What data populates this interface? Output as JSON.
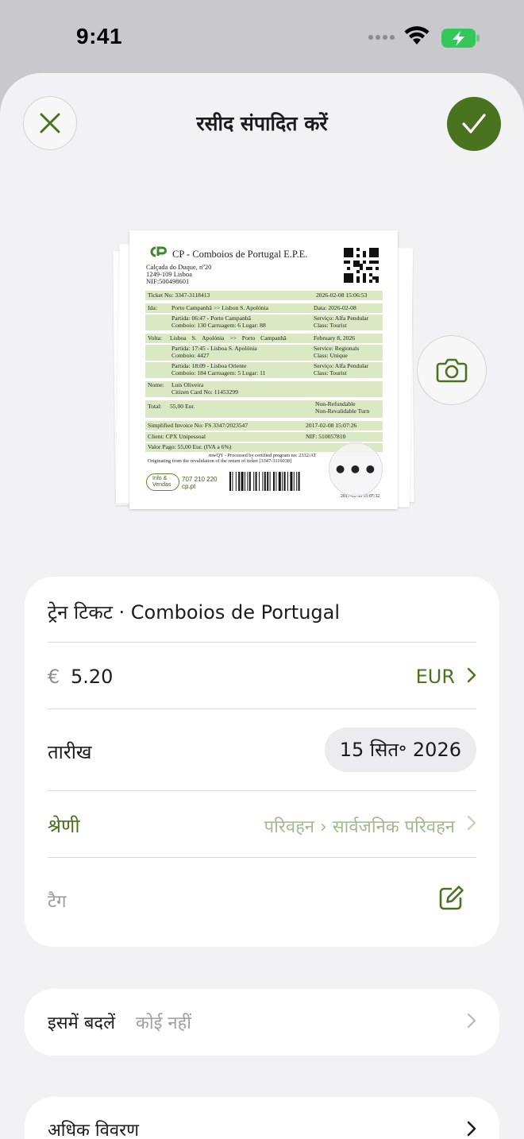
{
  "status_bar": {
    "time": "9:41"
  },
  "header": {
    "title": "रसीद संपादित करें"
  },
  "receipt": {
    "company": "CP - Comboios de Portugal E.P.E.",
    "address": [
      "Calçada do Duque, nº20",
      "1249-109 Lisboa",
      "NIF:500498601"
    ],
    "ticket_no": "Ticket No: 3347-3118413",
    "ticket_datetime": "2026-02-08 15:06:53",
    "ida_label": "Ida:",
    "ida_route": "Porto Campanhã >> Lisbon S. Apolónia",
    "ida_date": "Data: 2026-02-08",
    "ida_partida": "Partida: 06:47 - Porto Campanhã",
    "ida_comboio": "Comboio: 130 Carruagem: 6 Lugar: 88",
    "ida_servico": "Serviço: Alfa Pendular",
    "ida_class": "Class: Tourist",
    "volta_label": "Volta:",
    "volta_route": "Lisboa S. Apolónia >> Porto Campanhã",
    "volta_date": "February 8, 2026",
    "volta_partida1": "Partida: 17:45 - Lisboa S. Apolónia",
    "volta_comboio1": "Comboio: 4427",
    "volta_service1": "Service: Regionals",
    "volta_class1": "Class: Unique",
    "volta_partida2": "Partida: 18:09 - Lisboa Oriente",
    "volta_comboio2": "Comboio: 184 Carruagem: 5 Lugar: 11",
    "volta_servico2": "Serviço: Alfa Pendular",
    "volta_class2": "Class: Tourist",
    "name_label": "Nome:",
    "name_value": "Luis Oliveira",
    "citizen_card": "Citizen Card No: 11453299",
    "total_label": "Total:",
    "total_value": "55,00 Eur.",
    "non_refundable": "Non-Refundable",
    "non_revalidable": "Non-Revalidable Turn",
    "invoice": "Simplified Invoice No: FS 3347/2023547",
    "invoice_datetime": "2017-02-08 15:07:26",
    "client": "Client: CPX Unipessoal",
    "nif": "NIF: 510057810",
    "valor_pago": "Valor Pago: 55,00 Eur. (IVA a 6%)",
    "processed": "mwQY - Processed by certified program no: 2332/AT",
    "originating": "Originating from the revalidation of the return of ticket [3347-3116038]",
    "info_line1": "Info &",
    "info_line2": "Vendas",
    "phone": "707 210 220",
    "site": "cp.pt",
    "stamp": "2017-02-08 15:07:32"
  },
  "form": {
    "merchant": "ट्रेन टिकट · Comboios de Portugal",
    "currency_symbol": "€",
    "amount": "5.20",
    "currency": "EUR",
    "date_label": "तारीख",
    "date_value": "15 सित॰ 2026",
    "category_label": "श्रेणी",
    "category_value": "परिवहन › सार्वजनिक परिवहन",
    "tags_label": "टैग"
  },
  "replace": {
    "label": "इसमें बदलें",
    "value": "कोई नहीं"
  },
  "more_details": {
    "label": "अधिक विवरण"
  },
  "colors": {
    "accent": "#4a7320",
    "receipt_band": "#dbe8c4",
    "battery": "#34c759"
  },
  "icons": [
    "close-icon",
    "checkmark-icon",
    "camera-icon",
    "more-icon",
    "chevron-right-icon",
    "edit-icon",
    "wifi-icon",
    "battery-charging-icon",
    "cellular-icon"
  ]
}
